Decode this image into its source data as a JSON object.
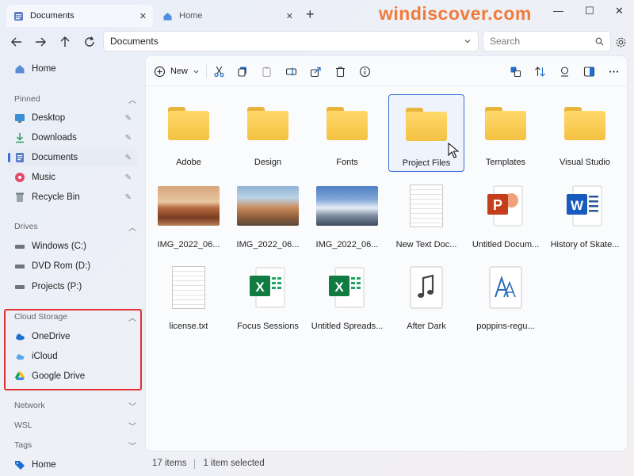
{
  "watermark": "windiscover.com",
  "tabs": [
    {
      "label": "Documents",
      "icon": "documents-icon"
    },
    {
      "label": "Home",
      "icon": "home-icon"
    }
  ],
  "address": {
    "path": "Documents"
  },
  "search": {
    "placeholder": "Search"
  },
  "toolbar": {
    "new_label": "New"
  },
  "sidebar": {
    "home": "Home",
    "pinned_header": "Pinned",
    "pinned": [
      "Desktop",
      "Downloads",
      "Documents",
      "Music",
      "Recycle Bin"
    ],
    "drives_header": "Drives",
    "drives": [
      "Windows (C:)",
      "DVD Rom (D:)",
      "Projects (P:)"
    ],
    "cloud_header": "Cloud Storage",
    "cloud": [
      "OneDrive",
      "iCloud",
      "Google Drive"
    ],
    "network": "Network",
    "wsl": "WSL",
    "tags": "Tags",
    "home_bottom": "Home"
  },
  "files": [
    {
      "name": "Adobe",
      "kind": "folder"
    },
    {
      "name": "Design",
      "kind": "folder"
    },
    {
      "name": "Fonts",
      "kind": "folder"
    },
    {
      "name": "Project Files",
      "kind": "folder",
      "selected": true
    },
    {
      "name": "Templates",
      "kind": "folder"
    },
    {
      "name": "Visual Studio",
      "kind": "folder"
    },
    {
      "name": "IMG_2022_06...",
      "kind": "image"
    },
    {
      "name": "IMG_2022_06...",
      "kind": "image"
    },
    {
      "name": "IMG_2022_06...",
      "kind": "image"
    },
    {
      "name": "New Text Doc...",
      "kind": "text"
    },
    {
      "name": "Untitled Docum...",
      "kind": "powerpoint"
    },
    {
      "name": "History of Skate...",
      "kind": "word"
    },
    {
      "name": "license.txt",
      "kind": "text"
    },
    {
      "name": "Focus Sessions",
      "kind": "excel"
    },
    {
      "name": "Untitled Spreads...",
      "kind": "excel"
    },
    {
      "name": "After Dark",
      "kind": "audio"
    },
    {
      "name": "poppins-regu...",
      "kind": "font"
    }
  ],
  "status": {
    "count": "17 items",
    "selection": "1 item selected"
  },
  "colors": {
    "accent": "#3a6fd8",
    "highlight_box": "#e0312f",
    "folder": "#f4c142",
    "watermark": "#f07a3a"
  }
}
